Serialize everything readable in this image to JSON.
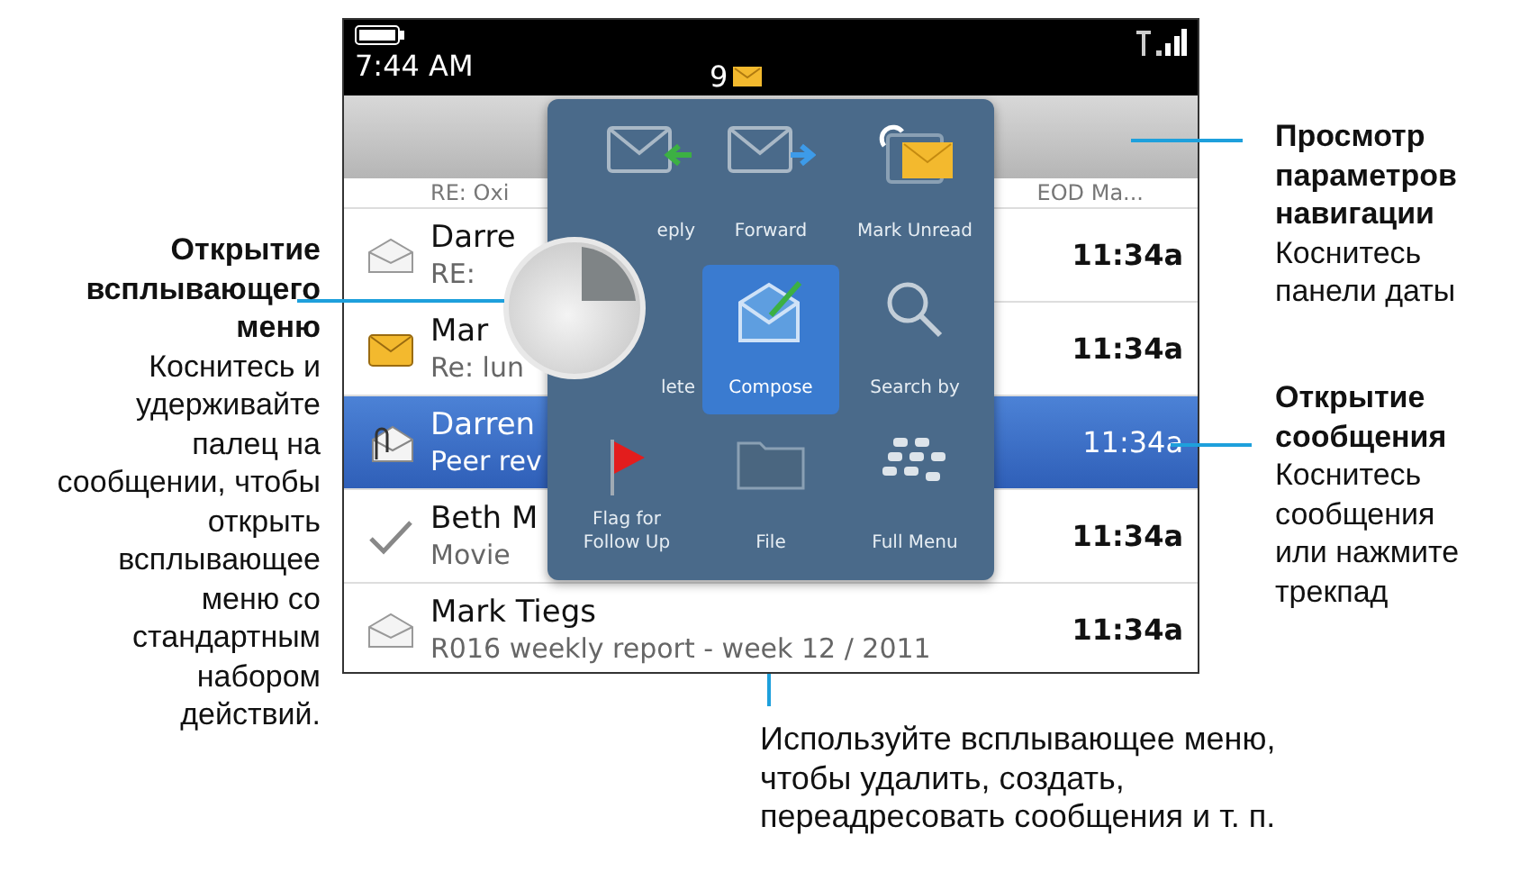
{
  "status_bar": {
    "time": "7:44 AM",
    "unread_count": "9"
  },
  "list_fragment": {
    "subject": "RE: Oxi",
    "right": "EOD Ma..."
  },
  "messages": [
    {
      "kind": "read",
      "sender": "Darre",
      "subject": "RE:",
      "time": "11:34a",
      "selected": false
    },
    {
      "kind": "unread",
      "sender": "Mar",
      "subject": "Re: lun",
      "time": "11:34a",
      "selected": false
    },
    {
      "kind": "attachment",
      "sender": "Darren",
      "subject": "Peer rev",
      "time": "11:34a",
      "selected": true
    },
    {
      "kind": "replied",
      "sender": "Beth M",
      "subject": "Movie",
      "time": "11:34a",
      "selected": false
    },
    {
      "kind": "read",
      "sender": "Mark Tiegs",
      "subject": "R016 weekly report - week 12 / 2011",
      "time": "11:34a",
      "selected": false
    }
  ],
  "popup_menu": [
    {
      "kind": "reply",
      "label": "eply",
      "selected": false
    },
    {
      "kind": "forward",
      "label": "Forward",
      "selected": false
    },
    {
      "kind": "mark-unread",
      "label": "Mark Unread",
      "selected": false
    },
    {
      "kind": "delete",
      "label": "lete",
      "selected": false
    },
    {
      "kind": "compose",
      "label": "Compose",
      "selected": true
    },
    {
      "kind": "search",
      "label": "Search by",
      "selected": false
    },
    {
      "kind": "flag",
      "label": "Flag for Follow Up",
      "selected": false
    },
    {
      "kind": "file",
      "label": "File",
      "selected": false
    },
    {
      "kind": "menu",
      "label": "Full Menu",
      "selected": false
    }
  ],
  "callout_left": {
    "title": "Открытие всплывающего меню",
    "body": "Коснитесь и удерживайте палец на сообщении, чтобы открыть всплывающее меню со стандартным набором действий."
  },
  "callout_top_right": {
    "title": "Просмотр параметров навигации",
    "body": "Коснитесь панели даты"
  },
  "callout_mid_right": {
    "title": "Открытие сообщения",
    "body": "Коснитесь сообщения или нажмите трекпад"
  },
  "callout_bottom": {
    "body": "Используйте всплывающее меню, чтобы удалить, создать, переадресовать сообщения и т. п."
  }
}
